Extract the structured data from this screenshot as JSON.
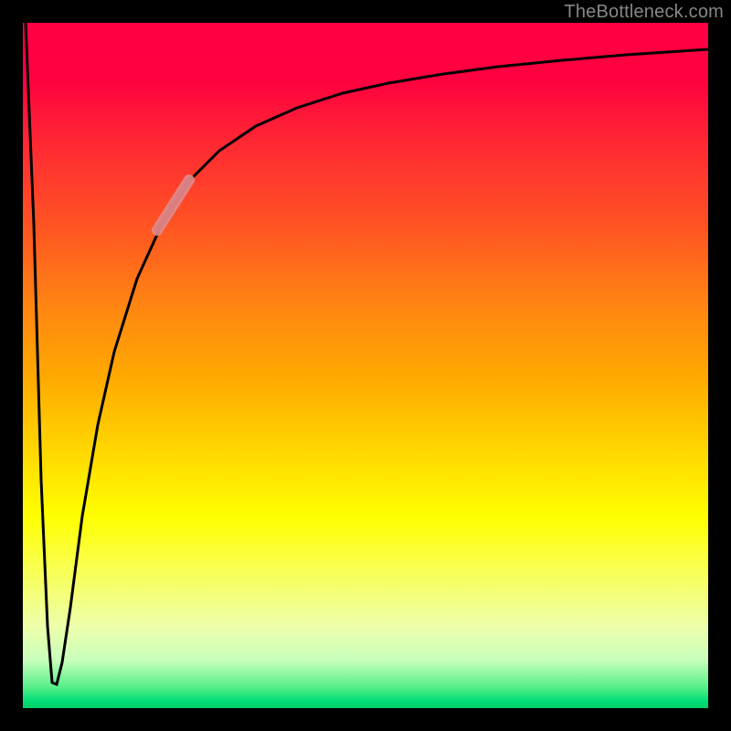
{
  "watermark": "TheBottleneck.com",
  "chart_data": {
    "type": "line",
    "title": "",
    "xlabel": "",
    "ylabel": "",
    "xlim": [
      0,
      100
    ],
    "ylim": [
      0,
      100
    ],
    "grid": false,
    "legend": false,
    "series": [
      {
        "name": "bottleneck-curve",
        "x": [
          0,
          2,
          3.5,
          4,
          4.8,
          6,
          8,
          10,
          13,
          16,
          20,
          25,
          30,
          35,
          40,
          50,
          60,
          70,
          80,
          90,
          100
        ],
        "values": [
          100,
          50,
          10,
          3,
          5,
          20,
          40,
          53,
          64,
          72,
          78,
          83,
          86.5,
          89,
          90.5,
          92.5,
          94,
          95,
          95.8,
          96.3,
          96.7
        ]
      }
    ],
    "highlight": {
      "name": "highlight-segment",
      "x_range": [
        19,
        24
      ],
      "approx_y_range": [
        77,
        82.5
      ],
      "color": "#e08a8a"
    },
    "background": "vertical-gradient-red-to-green",
    "notes": "Y axis represents compatibility (green near bottom = good, red near top = bad). Curve starts at top-left, dips sharply to near-zero around x≈4, then rises asymptotically toward ~97. A short pink/salmon highlight segment sits on the curve around x≈19–24."
  }
}
